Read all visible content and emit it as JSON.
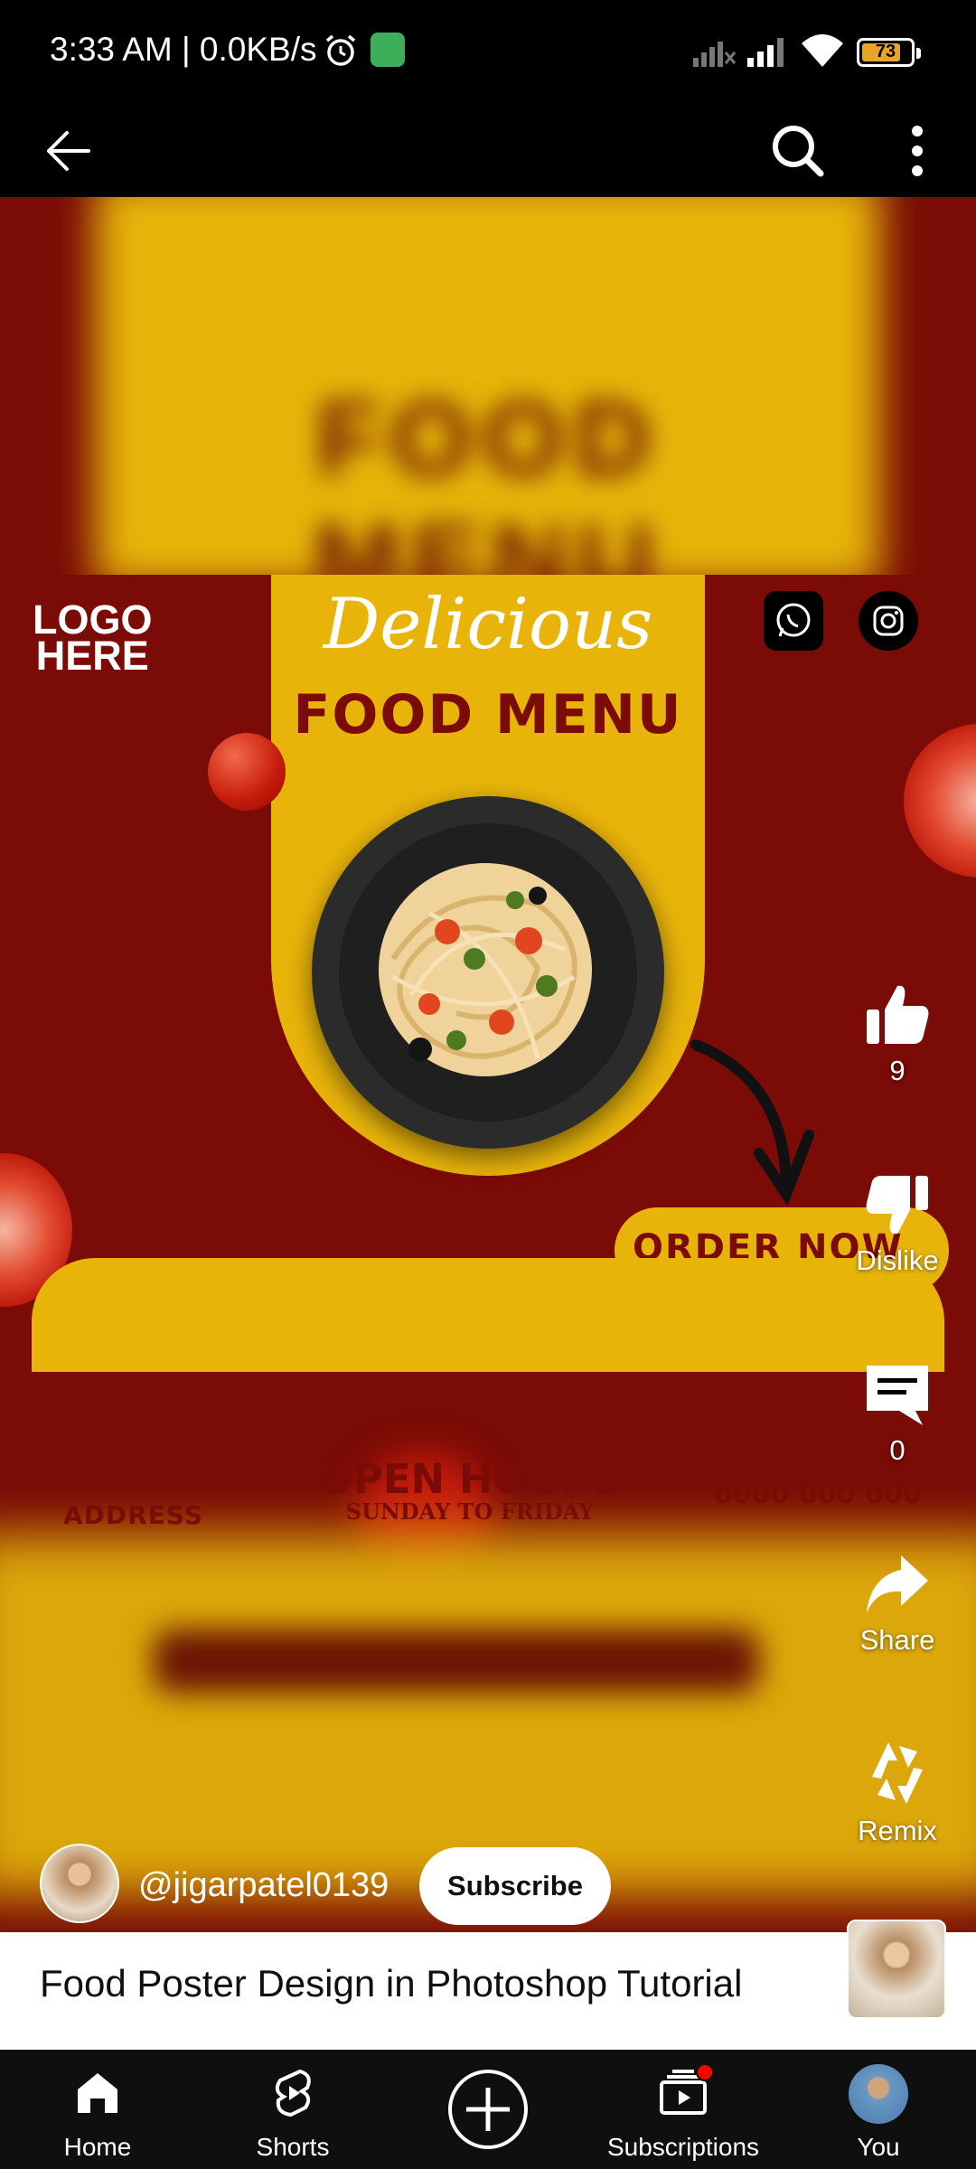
{
  "status_bar": {
    "time": "3:33 AM | 0.0KB/s",
    "battery_level": "73"
  },
  "poster": {
    "logo_line1": "LOGO",
    "logo_line2": "HERE",
    "script_title": "Delicious",
    "menu_title": "FOOD MENU",
    "order_label": "ORDER NOW",
    "address_label": "ADDRESS",
    "open_hours_label": "OPEN HOURS",
    "open_hours_sub": "SUNDAY TO FRIDAY",
    "phone": "0000 000 000"
  },
  "actions": {
    "like_count": "9",
    "dislike_label": "Dislike",
    "comment_count": "0",
    "share_label": "Share",
    "remix_label": "Remix"
  },
  "channel": {
    "handle": "@jigarpatel0139",
    "subscribe_label": "Subscribe"
  },
  "video": {
    "title": "Food Poster Design in Photoshop Tutorial"
  },
  "bottom_nav": {
    "items": [
      {
        "label": "Home",
        "icon": "home-icon"
      },
      {
        "label": "Shorts",
        "icon": "shorts-icon"
      },
      {
        "label": "",
        "icon": "create-plus-icon"
      },
      {
        "label": "Subscriptions",
        "icon": "subscriptions-icon"
      },
      {
        "label": "You",
        "icon": "avatar"
      }
    ]
  },
  "colors": {
    "poster_red": "#7a0b06",
    "poster_yellow": "#e9b40a",
    "notification_red": "#ff0000"
  }
}
